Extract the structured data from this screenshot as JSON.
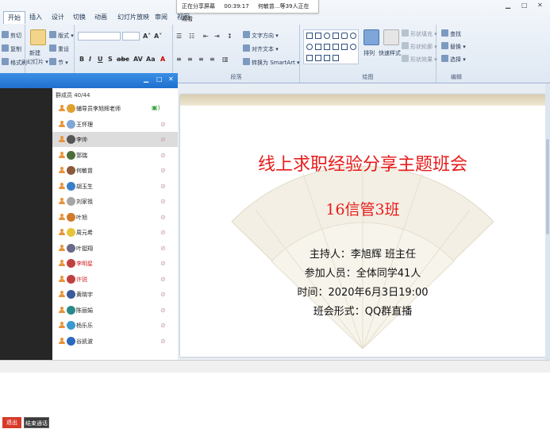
{
  "ribbon": {
    "tabs": [
      "开始",
      "插入",
      "设计",
      "切换",
      "动画",
      "幻灯片放映",
      "审阅",
      "视图"
    ],
    "clipboard": {
      "cut": "剪切",
      "copy": "复制",
      "format_painter": "格式刷"
    },
    "slides": {
      "new_slide": "新建",
      "new_slide_2": "幻灯片 ▾",
      "layout": "版式 ▾",
      "reset": "重设",
      "section": "节 ▾"
    },
    "paragraph": {
      "text_direction": "文字方向 ▾",
      "align_text": "对齐文本 ▾",
      "smartart": "转换为 SmartArt ▾",
      "label": "段落"
    },
    "drawing": {
      "arrange": "排列",
      "quick_styles": "快速样式",
      "shape_fill": "形状填充 ▾",
      "shape_outline": "形状轮廓 ▾",
      "shape_effects": "形状效果 ▾",
      "label": "绘图"
    },
    "editing": {
      "find": "查找",
      "replace": "替换 ▾",
      "select": "选择 ▾",
      "label": "编辑"
    }
  },
  "sharebar": {
    "status": "正在分享屏幕",
    "time": "00:39:17",
    "viewers": "何敏曾...等39人正在观看"
  },
  "qq": {
    "members_count": "群成员 40/44",
    "members": [
      {
        "name": "辅导员李旭辉老师",
        "red": false,
        "speaker": true,
        "avatar": "#e0a030"
      },
      {
        "name": "王怀理",
        "red": false,
        "speaker": false,
        "avatar": "#7fa6d6"
      },
      {
        "name": "李帅",
        "red": false,
        "speaker": false,
        "avatar": "#555555"
      },
      {
        "name": "郭瑞",
        "red": false,
        "speaker": false,
        "avatar": "#4d6e3a"
      },
      {
        "name": "何敏曾",
        "red": false,
        "speaker": false,
        "avatar": "#8a5a3a"
      },
      {
        "name": "胡玉生",
        "red": false,
        "speaker": false,
        "avatar": "#3a7fc7"
      },
      {
        "name": "刘家祖",
        "red": false,
        "speaker": false,
        "avatar": "#a6a6a6"
      },
      {
        "name": "叶旭",
        "red": false,
        "speaker": false,
        "avatar": "#d07a2a"
      },
      {
        "name": "周元希",
        "red": false,
        "speaker": false,
        "avatar": "#e8c43a"
      },
      {
        "name": "叶挺翔",
        "red": false,
        "speaker": false,
        "avatar": "#6a6a8a"
      },
      {
        "name": "李明星",
        "red": true,
        "speaker": false,
        "avatar": "#c04040"
      },
      {
        "name": "许锐",
        "red": true,
        "speaker": false,
        "avatar": "#c04040"
      },
      {
        "name": "黄晓宇",
        "red": false,
        "speaker": false,
        "avatar": "#3a5a9a"
      },
      {
        "name": "陈丽娟",
        "red": false,
        "speaker": false,
        "avatar": "#2a8a8a"
      },
      {
        "name": "杨乐乐",
        "red": false,
        "speaker": false,
        "avatar": "#3a9ad0"
      },
      {
        "name": "谷凯波",
        "red": false,
        "speaker": false,
        "avatar": "#2a6ac0"
      }
    ],
    "exit_label": "退出",
    "end_label": "结束通话"
  },
  "slide": {
    "title": "线上求职经验分享主题班会",
    "subtitle": "16信管3班",
    "host": "主持人：李旭辉  班主任",
    "participants": "参加人员：全体同学41人",
    "time": "时间：2020年6月3日19:00",
    "format": "班会形式：QQ群直播"
  },
  "colors": {
    "accent": "#1f70cf",
    "title_red": "#e81a1a"
  }
}
